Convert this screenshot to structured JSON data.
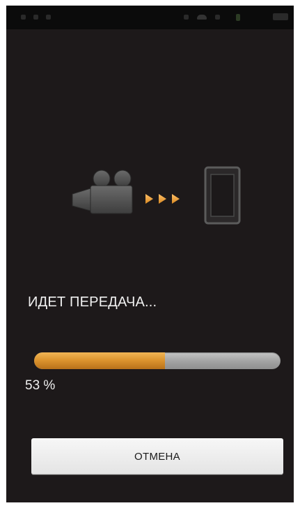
{
  "status_bar": {
    "icons": [
      "notification-icon",
      "notification-icon",
      "notification-icon",
      "wifi-icon",
      "signal-icon",
      "battery-icon"
    ]
  },
  "graphic": {
    "source_icon": "video-camera-icon",
    "arrows_icon": "transfer-arrows-icon",
    "target_icon": "smartphone-icon",
    "accent_color": "#f0a23a"
  },
  "transfer": {
    "status": "ИДЕТ ПЕРЕДАЧА...",
    "progress_percent": 53,
    "progress_label": "53 %",
    "progress_color": "#dd952f"
  },
  "actions": {
    "cancel_label": "ОТМЕНА"
  }
}
